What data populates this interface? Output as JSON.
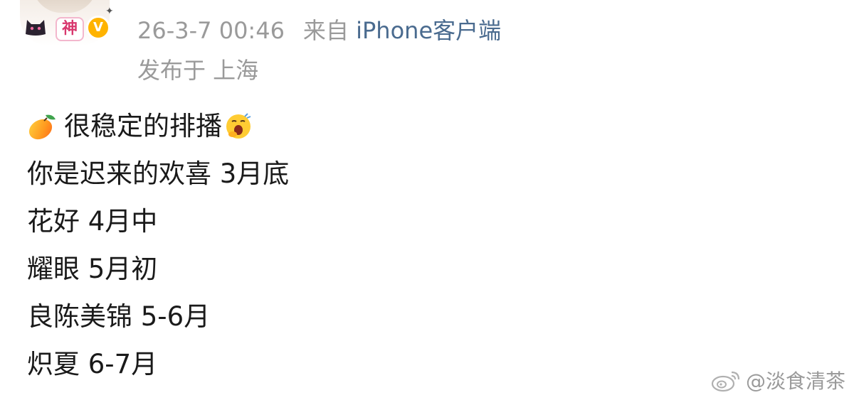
{
  "header": {
    "sticker_text": "神",
    "badge_text": "V",
    "sparkle": "✦",
    "timestamp": "26-3-7 00:46",
    "source_prefix": "来自",
    "source_client": "iPhone客户端",
    "location": "发布于 上海"
  },
  "post": {
    "lines": [
      {
        "text": "很稳定的排播",
        "lead_icon": "mango-icon",
        "trail_icon": "yawn-icon"
      },
      {
        "text": "你是迟来的欢喜 3月底"
      },
      {
        "text": "花好 4月中"
      },
      {
        "text": "耀眼 5月初"
      },
      {
        "text": "良陈美锦 5-6月"
      },
      {
        "text": "炽夏 6-7月"
      }
    ]
  },
  "watermark": {
    "icon": "weibo-logo-icon",
    "text": "@淡食清茶"
  },
  "colors": {
    "meta_gray": "#9a9a9a",
    "link_blue": "#4a6b8f",
    "body_text": "#1a1a1a",
    "verified_gold": "#ffb300"
  }
}
